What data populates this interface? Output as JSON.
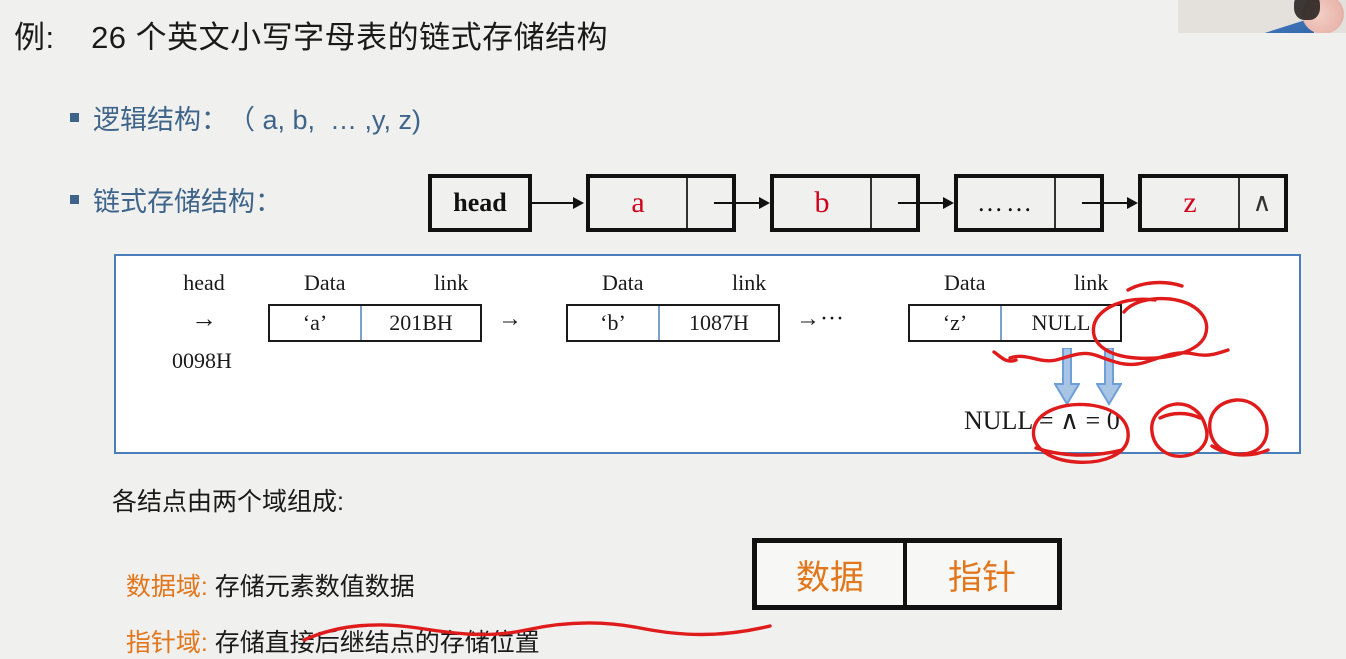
{
  "slide": {
    "title": "例:    26 个英文小写字母表的链式存储结构",
    "bullets": [
      {
        "label": "逻辑结构：",
        "value": "（ a, b,  … ,y, z)"
      },
      {
        "label": "链式存储结构：",
        "value": ""
      }
    ]
  },
  "chain": {
    "head_label": "head",
    "nodes": [
      {
        "data": "a",
        "link": ""
      },
      {
        "data": "b",
        "link": ""
      },
      {
        "data": "……",
        "link": ""
      },
      {
        "data": "z",
        "link": "∧"
      }
    ]
  },
  "memory": {
    "head_label": "head",
    "head_arrow": "→",
    "head_address": "0098H",
    "col_data": "Data",
    "col_link": "link",
    "arrow_between": "→",
    "arrow_ellipsis": "→···",
    "cells": [
      {
        "data": "‘a’",
        "link": "201BH"
      },
      {
        "data": "‘b’",
        "link": "1087H"
      },
      {
        "data": "‘z’",
        "link": "NULL"
      }
    ],
    "null_equation": "NULL = ∧ = 0"
  },
  "explanation": {
    "intro": "各结点由两个域组成:",
    "items": [
      {
        "key": "数据域:",
        "value": " 存储元素数值数据"
      },
      {
        "key": "指针域:",
        "value": " 存储直接后继结点的存储位置"
      }
    ]
  },
  "field_legend": {
    "data_cell": "数据",
    "pointer_cell": "指针"
  },
  "colors": {
    "background": "#f0f0ef",
    "bullet_blue": "#3e6489",
    "node_letter_red": "#d0021b",
    "orange": "#e2761b",
    "panel_border_blue": "#4a7ebb",
    "ink_red": "#e01b1b",
    "blue_arrow": "#6f9fd8"
  }
}
